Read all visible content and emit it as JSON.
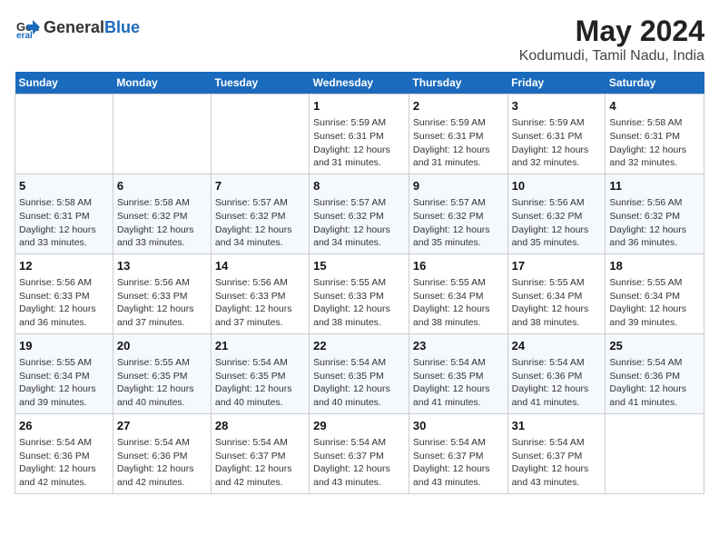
{
  "header": {
    "logo_general": "General",
    "logo_blue": "Blue",
    "month_year": "May 2024",
    "location": "Kodumudi, Tamil Nadu, India"
  },
  "days_of_week": [
    "Sunday",
    "Monday",
    "Tuesday",
    "Wednesday",
    "Thursday",
    "Friday",
    "Saturday"
  ],
  "weeks": [
    [
      {
        "day": "",
        "info": ""
      },
      {
        "day": "",
        "info": ""
      },
      {
        "day": "",
        "info": ""
      },
      {
        "day": "1",
        "info": "Sunrise: 5:59 AM\nSunset: 6:31 PM\nDaylight: 12 hours\nand 31 minutes."
      },
      {
        "day": "2",
        "info": "Sunrise: 5:59 AM\nSunset: 6:31 PM\nDaylight: 12 hours\nand 31 minutes."
      },
      {
        "day": "3",
        "info": "Sunrise: 5:59 AM\nSunset: 6:31 PM\nDaylight: 12 hours\nand 32 minutes."
      },
      {
        "day": "4",
        "info": "Sunrise: 5:58 AM\nSunset: 6:31 PM\nDaylight: 12 hours\nand 32 minutes."
      }
    ],
    [
      {
        "day": "5",
        "info": "Sunrise: 5:58 AM\nSunset: 6:31 PM\nDaylight: 12 hours\nand 33 minutes."
      },
      {
        "day": "6",
        "info": "Sunrise: 5:58 AM\nSunset: 6:32 PM\nDaylight: 12 hours\nand 33 minutes."
      },
      {
        "day": "7",
        "info": "Sunrise: 5:57 AM\nSunset: 6:32 PM\nDaylight: 12 hours\nand 34 minutes."
      },
      {
        "day": "8",
        "info": "Sunrise: 5:57 AM\nSunset: 6:32 PM\nDaylight: 12 hours\nand 34 minutes."
      },
      {
        "day": "9",
        "info": "Sunrise: 5:57 AM\nSunset: 6:32 PM\nDaylight: 12 hours\nand 35 minutes."
      },
      {
        "day": "10",
        "info": "Sunrise: 5:56 AM\nSunset: 6:32 PM\nDaylight: 12 hours\nand 35 minutes."
      },
      {
        "day": "11",
        "info": "Sunrise: 5:56 AM\nSunset: 6:32 PM\nDaylight: 12 hours\nand 36 minutes."
      }
    ],
    [
      {
        "day": "12",
        "info": "Sunrise: 5:56 AM\nSunset: 6:33 PM\nDaylight: 12 hours\nand 36 minutes."
      },
      {
        "day": "13",
        "info": "Sunrise: 5:56 AM\nSunset: 6:33 PM\nDaylight: 12 hours\nand 37 minutes."
      },
      {
        "day": "14",
        "info": "Sunrise: 5:56 AM\nSunset: 6:33 PM\nDaylight: 12 hours\nand 37 minutes."
      },
      {
        "day": "15",
        "info": "Sunrise: 5:55 AM\nSunset: 6:33 PM\nDaylight: 12 hours\nand 38 minutes."
      },
      {
        "day": "16",
        "info": "Sunrise: 5:55 AM\nSunset: 6:34 PM\nDaylight: 12 hours\nand 38 minutes."
      },
      {
        "day": "17",
        "info": "Sunrise: 5:55 AM\nSunset: 6:34 PM\nDaylight: 12 hours\nand 38 minutes."
      },
      {
        "day": "18",
        "info": "Sunrise: 5:55 AM\nSunset: 6:34 PM\nDaylight: 12 hours\nand 39 minutes."
      }
    ],
    [
      {
        "day": "19",
        "info": "Sunrise: 5:55 AM\nSunset: 6:34 PM\nDaylight: 12 hours\nand 39 minutes."
      },
      {
        "day": "20",
        "info": "Sunrise: 5:55 AM\nSunset: 6:35 PM\nDaylight: 12 hours\nand 40 minutes."
      },
      {
        "day": "21",
        "info": "Sunrise: 5:54 AM\nSunset: 6:35 PM\nDaylight: 12 hours\nand 40 minutes."
      },
      {
        "day": "22",
        "info": "Sunrise: 5:54 AM\nSunset: 6:35 PM\nDaylight: 12 hours\nand 40 minutes."
      },
      {
        "day": "23",
        "info": "Sunrise: 5:54 AM\nSunset: 6:35 PM\nDaylight: 12 hours\nand 41 minutes."
      },
      {
        "day": "24",
        "info": "Sunrise: 5:54 AM\nSunset: 6:36 PM\nDaylight: 12 hours\nand 41 minutes."
      },
      {
        "day": "25",
        "info": "Sunrise: 5:54 AM\nSunset: 6:36 PM\nDaylight: 12 hours\nand 41 minutes."
      }
    ],
    [
      {
        "day": "26",
        "info": "Sunrise: 5:54 AM\nSunset: 6:36 PM\nDaylight: 12 hours\nand 42 minutes."
      },
      {
        "day": "27",
        "info": "Sunrise: 5:54 AM\nSunset: 6:36 PM\nDaylight: 12 hours\nand 42 minutes."
      },
      {
        "day": "28",
        "info": "Sunrise: 5:54 AM\nSunset: 6:37 PM\nDaylight: 12 hours\nand 42 minutes."
      },
      {
        "day": "29",
        "info": "Sunrise: 5:54 AM\nSunset: 6:37 PM\nDaylight: 12 hours\nand 43 minutes."
      },
      {
        "day": "30",
        "info": "Sunrise: 5:54 AM\nSunset: 6:37 PM\nDaylight: 12 hours\nand 43 minutes."
      },
      {
        "day": "31",
        "info": "Sunrise: 5:54 AM\nSunset: 6:37 PM\nDaylight: 12 hours\nand 43 minutes."
      },
      {
        "day": "",
        "info": ""
      }
    ]
  ]
}
